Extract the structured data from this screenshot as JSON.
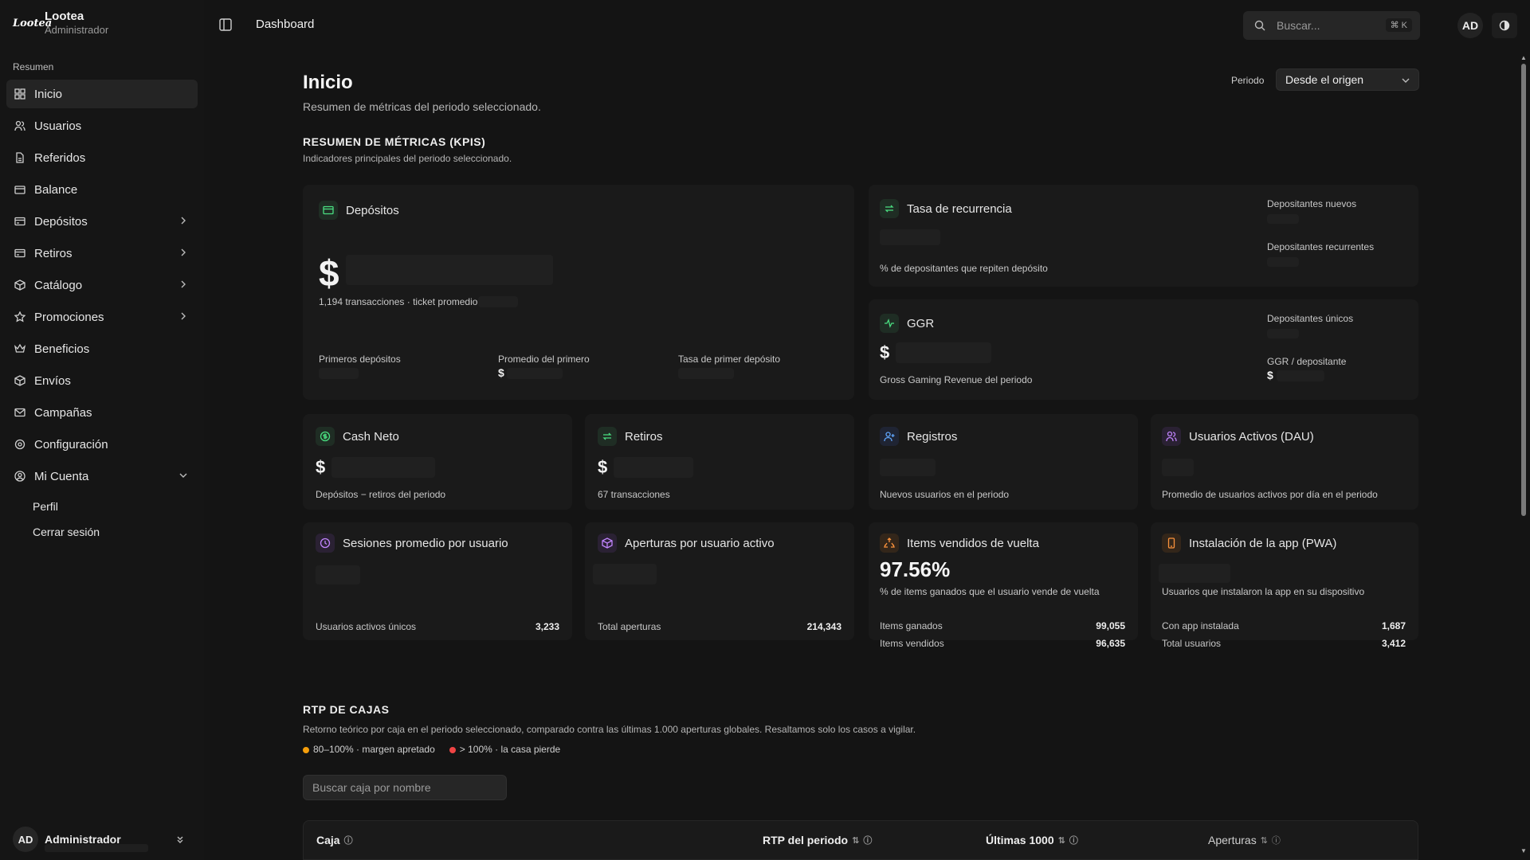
{
  "brand": {
    "logo": "Lootea",
    "name": "Lootea",
    "role": "Administrador"
  },
  "sidebar": {
    "section": "Resumen",
    "items": [
      {
        "label": "Inicio",
        "icon": "grid-icon"
      },
      {
        "label": "Usuarios",
        "icon": "users-icon"
      },
      {
        "label": "Referidos",
        "icon": "file-icon"
      },
      {
        "label": "Balance",
        "icon": "wallet-icon"
      },
      {
        "label": "Depósitos",
        "icon": "card-icon"
      },
      {
        "label": "Retiros",
        "icon": "card-icon"
      },
      {
        "label": "Catálogo",
        "icon": "box-icon"
      },
      {
        "label": "Promociones",
        "icon": "star-icon"
      },
      {
        "label": "Beneficios",
        "icon": "crown-icon"
      },
      {
        "label": "Envíos",
        "icon": "package-icon"
      },
      {
        "label": "Campañas",
        "icon": "mail-icon"
      },
      {
        "label": "Configuración",
        "icon": "gear-icon"
      },
      {
        "label": "Mi Cuenta",
        "icon": "user-circle-icon"
      }
    ],
    "sub_items": [
      "Perfil",
      "Cerrar sesión"
    ],
    "user": {
      "initials": "AD",
      "name": "Administrador"
    }
  },
  "topbar": {
    "title": "Dashboard",
    "search_placeholder": "Buscar...",
    "shortcut": "⌘ K",
    "avatar": "AD"
  },
  "page": {
    "title": "Inicio",
    "subtitle": "Resumen de métricas del periodo seleccionado.",
    "period_label": "Periodo",
    "period_value": "Desde el origen"
  },
  "kpis": {
    "title": "RESUMEN DE MÉTRICAS (KPIS)",
    "subtitle": "Indicadores principales del periodo seleccionado.",
    "depositos": {
      "title": "Depósitos",
      "currency": "$",
      "detail": "1,194 transacciones · ticket promedio",
      "primeros": "Primeros depósitos",
      "promedio": "Promedio del primero",
      "tasa": "Tasa de primer depósito",
      "promedio_currency": "$"
    },
    "recurrencia": {
      "title": "Tasa de recurrencia",
      "desc": "% de depositantes que repiten depósito",
      "nuevos": "Depositantes nuevos",
      "recurrentes": "Depositantes recurrentes"
    },
    "ggr": {
      "title": "GGR",
      "currency": "$",
      "desc": "Gross Gaming Revenue del periodo",
      "unicos": "Depositantes únicos",
      "por_dep": "GGR / depositante",
      "por_dep_currency": "$"
    },
    "cash": {
      "title": "Cash Neto",
      "currency": "$",
      "desc": "Depósitos − retiros del periodo"
    },
    "retiros": {
      "title": "Retiros",
      "currency": "$",
      "desc": "67 transacciones"
    },
    "registros": {
      "title": "Registros",
      "desc": "Nuevos usuarios en el periodo"
    },
    "dau": {
      "title": "Usuarios Activos (DAU)",
      "desc": "Promedio de usuarios activos por día en el periodo"
    },
    "sesiones": {
      "title": "Sesiones promedio por usuario",
      "row_label": "Usuarios activos únicos",
      "row_value": "3,233"
    },
    "aperturas": {
      "title": "Aperturas por usuario activo",
      "row_label": "Total aperturas",
      "row_value": "214,343"
    },
    "items": {
      "title": "Items vendidos de vuelta",
      "value": "97.56%",
      "desc": "% de items ganados que el usuario vende de vuelta",
      "r1_label": "Items ganados",
      "r1_value": "99,055",
      "r2_label": "Items vendidos",
      "r2_value": "96,635"
    },
    "pwa": {
      "title": "Instalación de la app (PWA)",
      "desc": "Usuarios que instalaron la app en su dispositivo",
      "r1_label": "Con app instalada",
      "r1_value": "1,687",
      "r2_label": "Total usuarios",
      "r2_value": "3,412"
    }
  },
  "rtp": {
    "title": "RTP DE CAJAS",
    "subtitle": "Retorno teórico por caja en el periodo seleccionado, comparado contra las últimas 1.000 aperturas globales. Resaltamos solo los casos a vigilar.",
    "legend": [
      {
        "label": "80–100% · margen apretado",
        "color": "#f59e0b"
      },
      {
        "label": "> 100% · la casa pierde",
        "color": "#ef4444"
      }
    ],
    "search_placeholder": "Buscar caja por nombre",
    "columns": [
      "Caja",
      "RTP del periodo",
      "Últimas 1000",
      "Aperturas"
    ]
  }
}
